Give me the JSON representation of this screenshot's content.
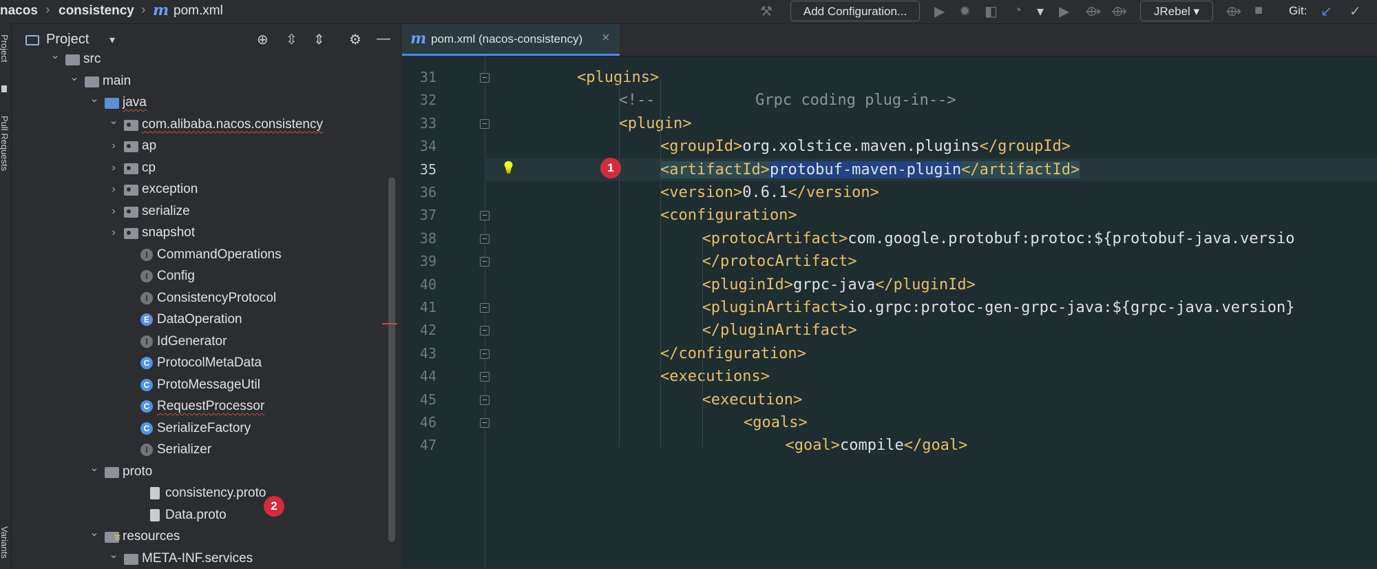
{
  "breadcrumb": {
    "items": [
      "nacos",
      "consistency",
      "pom.xml"
    ]
  },
  "toolbar": {
    "add_config_label": "Add Configuration...",
    "jrebel_label": "JRebel",
    "git_label": "Git:"
  },
  "left_strip": {
    "labels": [
      "Project",
      "Pull Requests",
      "Variants"
    ]
  },
  "project_panel": {
    "title": "Project",
    "tree": [
      {
        "label": "src",
        "kind": "folder",
        "depth": 2,
        "expanded": true,
        "error": false
      },
      {
        "label": "main",
        "kind": "folder",
        "depth": 3,
        "expanded": true,
        "error": false
      },
      {
        "label": "java",
        "kind": "folder-blue",
        "depth": 4,
        "expanded": true,
        "error": true
      },
      {
        "label": "com.alibaba.nacos.consistency",
        "kind": "package",
        "depth": 5,
        "expanded": true,
        "error": true
      },
      {
        "label": "ap",
        "kind": "package",
        "depth": 6,
        "expanded": false,
        "error": false
      },
      {
        "label": "cp",
        "kind": "package",
        "depth": 6,
        "expanded": false,
        "error": false
      },
      {
        "label": "exception",
        "kind": "package",
        "depth": 6,
        "expanded": false,
        "error": false
      },
      {
        "label": "serialize",
        "kind": "package",
        "depth": 6,
        "expanded": false,
        "error": false
      },
      {
        "label": "snapshot",
        "kind": "package",
        "depth": 6,
        "expanded": false,
        "error": false
      },
      {
        "label": "CommandOperations",
        "kind": "interface",
        "depth": 6,
        "error": false
      },
      {
        "label": "Config",
        "kind": "interface",
        "depth": 6,
        "error": false
      },
      {
        "label": "ConsistencyProtocol",
        "kind": "interface",
        "depth": 6,
        "error": false
      },
      {
        "label": "DataOperation",
        "kind": "enum",
        "depth": 6,
        "error": false
      },
      {
        "label": "IdGenerator",
        "kind": "interface",
        "depth": 6,
        "error": false
      },
      {
        "label": "ProtocolMetaData",
        "kind": "class",
        "depth": 6,
        "error": false
      },
      {
        "label": "ProtoMessageUtil",
        "kind": "class",
        "depth": 6,
        "error": false
      },
      {
        "label": "RequestProcessor",
        "kind": "class",
        "depth": 6,
        "error": true
      },
      {
        "label": "SerializeFactory",
        "kind": "class",
        "depth": 6,
        "error": false
      },
      {
        "label": "Serializer",
        "kind": "interface",
        "depth": 6,
        "error": false
      },
      {
        "label": "proto",
        "kind": "folder",
        "depth": 4,
        "expanded": true,
        "error": false
      },
      {
        "label": "consistency.proto",
        "kind": "file",
        "depth": 5,
        "error": false
      },
      {
        "label": "Data.proto",
        "kind": "file",
        "depth": 5,
        "error": false
      },
      {
        "label": "resources",
        "kind": "folder-res",
        "depth": 4,
        "expanded": true,
        "error": false
      },
      {
        "label": "META-INF.services",
        "kind": "folder",
        "depth": 5,
        "expanded": true,
        "error": false
      }
    ]
  },
  "editor": {
    "tab_title": "pom.xml (nacos-consistency)",
    "current_line": 35,
    "lines": [
      {
        "no": 31,
        "indent": 2,
        "segs": [
          [
            "tag",
            "<plugins>"
          ]
        ],
        "fold": "open"
      },
      {
        "no": 32,
        "indent": 3,
        "segs": [
          [
            "cmt",
            "<!--           Grpc coding plug-in-->"
          ]
        ],
        "fold": ""
      },
      {
        "no": 33,
        "indent": 3,
        "segs": [
          [
            "tag",
            "<plugin>"
          ]
        ],
        "fold": "open"
      },
      {
        "no": 34,
        "indent": 4,
        "segs": [
          [
            "tag",
            "<groupId>"
          ],
          [
            "txt",
            "org.xolstice.maven.plugins"
          ],
          [
            "tag",
            "</groupId>"
          ]
        ],
        "fold": ""
      },
      {
        "no": 35,
        "indent": 4,
        "segs": [
          [
            "tag",
            "<artifactId>"
          ],
          [
            "txt",
            "protobuf-maven-plugin"
          ],
          [
            "tag",
            "</artifactId>"
          ]
        ],
        "fold": ""
      },
      {
        "no": 36,
        "indent": 4,
        "segs": [
          [
            "tag",
            "<version>"
          ],
          [
            "txt",
            "0.6.1"
          ],
          [
            "tag",
            "</version>"
          ]
        ],
        "fold": ""
      },
      {
        "no": 37,
        "indent": 4,
        "segs": [
          [
            "tag",
            "<configuration>"
          ]
        ],
        "fold": "open"
      },
      {
        "no": 38,
        "indent": 5,
        "segs": [
          [
            "tag",
            "<protocArtifact>"
          ],
          [
            "txt",
            "com.google.protobuf:protoc:${protobuf-java.versio"
          ]
        ],
        "fold": "open"
      },
      {
        "no": 39,
        "indent": 5,
        "segs": [
          [
            "tag",
            "</protocArtifact>"
          ]
        ],
        "fold": "close"
      },
      {
        "no": 40,
        "indent": 5,
        "segs": [
          [
            "tag",
            "<pluginId>"
          ],
          [
            "txt",
            "grpc-java"
          ],
          [
            "tag",
            "</pluginId>"
          ]
        ],
        "fold": ""
      },
      {
        "no": 41,
        "indent": 5,
        "segs": [
          [
            "tag",
            "<pluginArtifact>"
          ],
          [
            "txt",
            "io.grpc:protoc-gen-grpc-java:${grpc-java.version}"
          ]
        ],
        "fold": "open"
      },
      {
        "no": 42,
        "indent": 5,
        "segs": [
          [
            "tag",
            "</pluginArtifact>"
          ]
        ],
        "fold": "close"
      },
      {
        "no": 43,
        "indent": 4,
        "segs": [
          [
            "tag",
            "</configuration>"
          ]
        ],
        "fold": "close"
      },
      {
        "no": 44,
        "indent": 4,
        "segs": [
          [
            "tag",
            "<executions>"
          ]
        ],
        "fold": "open"
      },
      {
        "no": 45,
        "indent": 5,
        "segs": [
          [
            "tag",
            "<execution>"
          ]
        ],
        "fold": "open"
      },
      {
        "no": 46,
        "indent": 6,
        "segs": [
          [
            "tag",
            "<goals>"
          ]
        ],
        "fold": "open"
      },
      {
        "no": 47,
        "indent": 7,
        "segs": [
          [
            "tag",
            "<goal>"
          ],
          [
            "txt",
            "compile"
          ],
          [
            "tag",
            "</goal>"
          ]
        ],
        "fold": ""
      }
    ]
  },
  "annotations": {
    "badge1": "1",
    "badge2": "2"
  },
  "colors": {
    "editor_bg": "#1e2d30",
    "tag": "#e8bf6a",
    "selection": "#214283",
    "badge": "#d52b3c",
    "accent": "#4d8af0"
  }
}
